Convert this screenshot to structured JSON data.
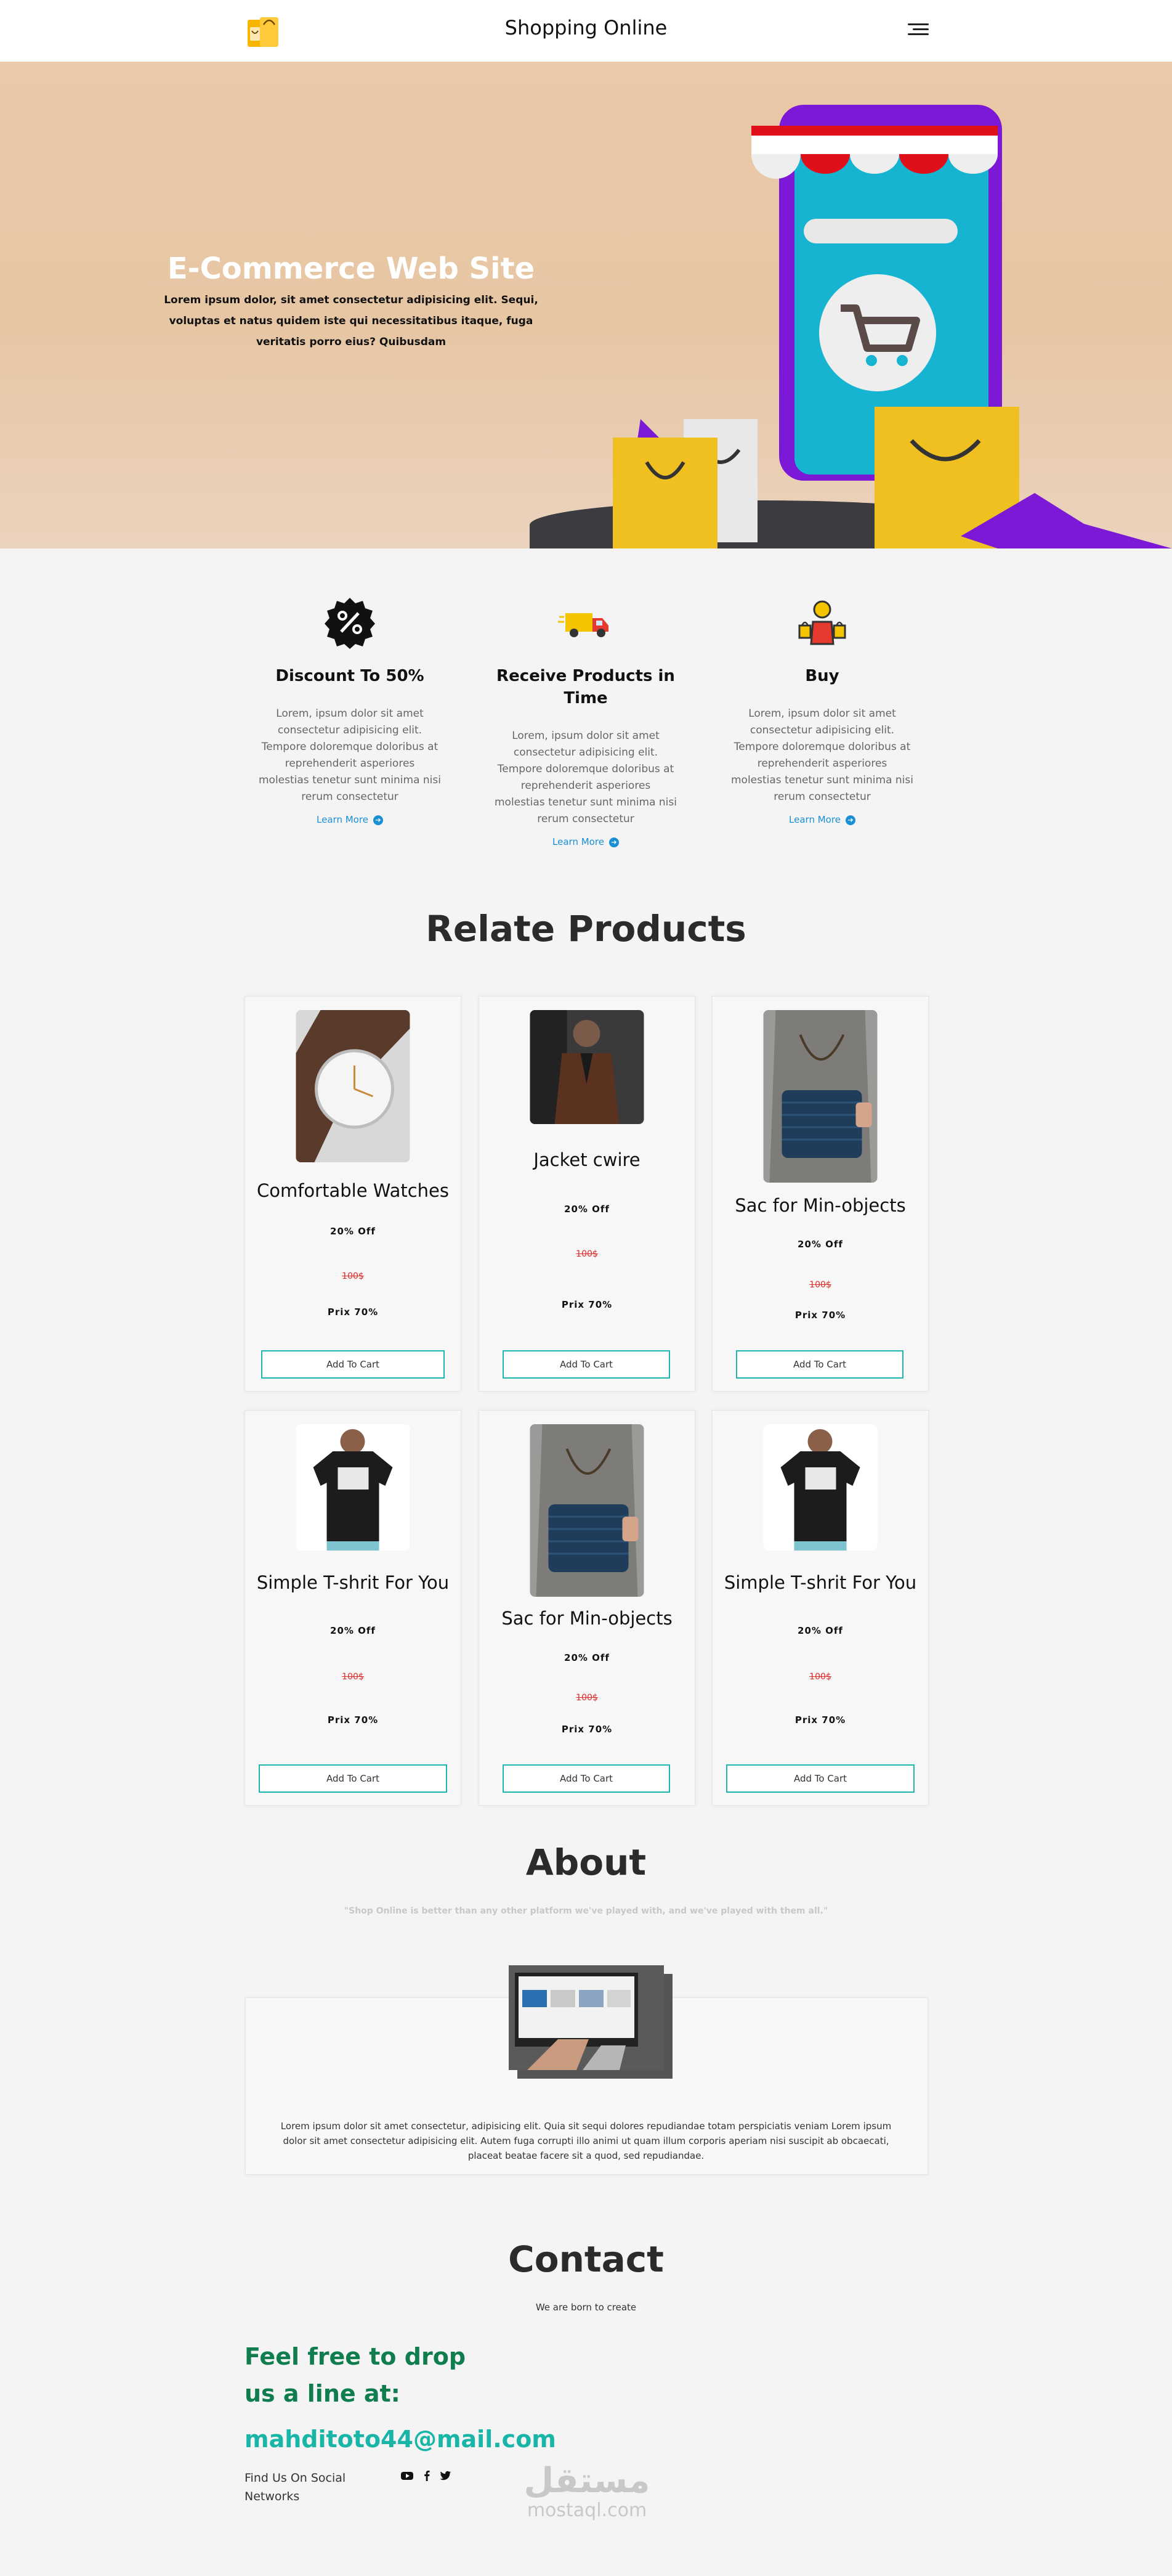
{
  "navbar": {
    "title": "Shopping Online",
    "logo_icon": "shopping-bag-logo-icon",
    "menu_icon": "hamburger-menu-icon"
  },
  "hero": {
    "title": "E-Commerce Web Site",
    "text": "Lorem ipsum dolor, sit amet consectetur adipisicing elit. Sequi, voluptas et natus quidem iste qui necessitatibus itaque, fuga veritatis porro eius? Quibusdam",
    "illustration_icon": "phone-shop-cart-illustration"
  },
  "features": [
    {
      "icon": "percent-badge-icon",
      "title": "Discount To 50%",
      "text": "Lorem, ipsum dolor sit amet consectetur adipisicing elit. Tempore doloremque doloribus at reprehenderit asperiores molestias tenetur sunt minima nisi rerum consectetur",
      "link": "Learn More"
    },
    {
      "icon": "delivery-truck-icon",
      "title": "Receive Products in Time",
      "text": "Lorem, ipsum dolor sit amet consectetur adipisicing elit. Tempore doloremque doloribus at reprehenderit asperiores molestias tenetur sunt minima nisi rerum consectetur",
      "link": "Learn More"
    },
    {
      "icon": "shopper-bags-icon",
      "title": "Buy",
      "text": "Lorem, ipsum dolor sit amet consectetur adipisicing elit. Tempore doloremque doloribus at reprehenderit asperiores molestias tenetur sunt minima nisi rerum consectetur",
      "link": "Learn More"
    }
  ],
  "products": {
    "title": "Relate Products",
    "items": [
      {
        "name": "Comfortable Watches",
        "discount": "20% Off",
        "old_price": "100$",
        "prix": "Prix 70%",
        "button": "Add To Cart",
        "image": "watch-image"
      },
      {
        "name": "Jacket cwire",
        "discount": "20% Off",
        "old_price": "100$",
        "prix": "Prix 70%",
        "button": "Add To Cart",
        "image": "jacket-image"
      },
      {
        "name": "Sac for Min-objects",
        "discount": "20% Off",
        "old_price": "100$",
        "prix": "Prix 70%",
        "button": "Add To Cart",
        "image": "bag-image"
      },
      {
        "name": "Simple T-shrit For You",
        "discount": "20% Off",
        "old_price": "100$",
        "prix": "Prix 70%",
        "button": "Add To Cart",
        "image": "tshirt-image"
      },
      {
        "name": "Sac for Min-objects",
        "discount": "20% Off",
        "old_price": "100$",
        "prix": "Prix 70%",
        "button": "Add To Cart",
        "image": "bag-image"
      },
      {
        "name": "Simple T-shrit For You",
        "discount": "20% Off",
        "old_price": "100$",
        "prix": "Prix 70%",
        "button": "Add To Cart",
        "image": "tshirt-image"
      }
    ]
  },
  "about": {
    "title": "About",
    "quote": "\"Shop Online is better than any other platform we've played with, and we've played with them all.\"",
    "image": "laptop-image",
    "text": "Lorem ipsum dolor sit amet consectetur, adipisicing elit. Quia sit sequi dolores repudiandae totam perspiciatis veniam Lorem ipsum dolor sit amet consectetur adipisicing elit. Autem fuga corrupti illo animi ut quam illum corporis aperiam nisi suscipit ab obcaecati, placeat beatae facere sit a quod, sed repudiandae."
  },
  "contact": {
    "title": "Contact",
    "subtitle": "We are born to create",
    "heading": "Feel free to drop us a line at:",
    "email": "mahditoto44@mail.com",
    "social_label": "Find Us On Social Networks",
    "social_icons": [
      "youtube-icon",
      "facebook-icon",
      "twitter-icon"
    ]
  },
  "watermark": {
    "arabic": "مستقل",
    "latin": "mostaql.com"
  },
  "colors": {
    "accent_teal": "#1cb5b0",
    "heading_green": "#0f7d4d",
    "link_blue": "#1a8fd6",
    "old_price_red": "#e02a2a"
  }
}
